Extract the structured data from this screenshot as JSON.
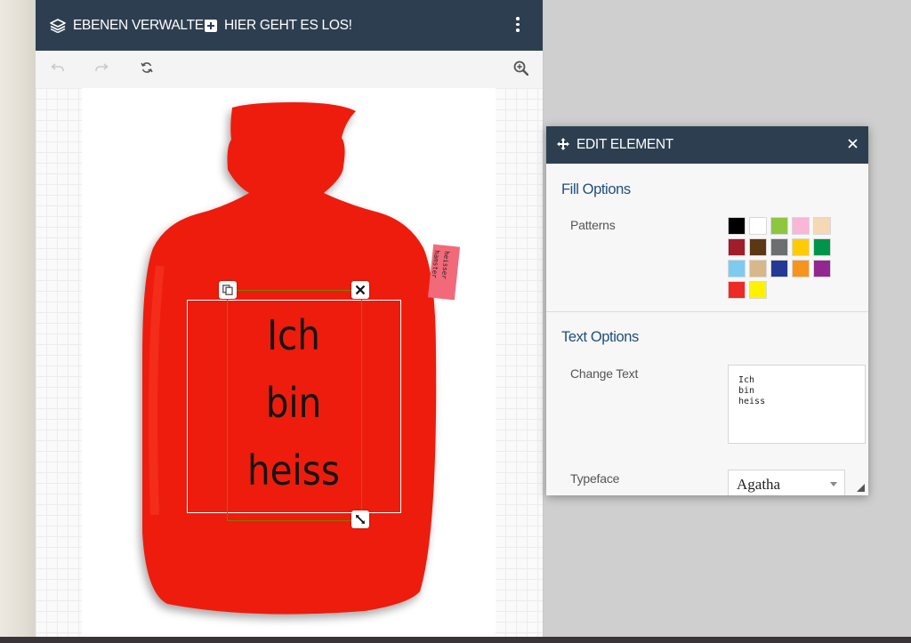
{
  "topbar": {
    "layers_label": "EBENEN VERWALTEN",
    "start_label": "HIER GEHT ES LOS!"
  },
  "toolbar": {
    "icons": [
      "undo-icon",
      "redo-icon",
      "refresh-icon",
      "zoom-in-icon"
    ]
  },
  "product": {
    "tag_text_line1": "heisser",
    "tag_text_line2": "hamster",
    "bottle_color": "#ee1f10"
  },
  "design": {
    "text_lines": [
      "Ich",
      "bin",
      "heiss"
    ]
  },
  "edit_panel": {
    "title": "EDIT ELEMENT",
    "fill_options_title": "Fill Options",
    "patterns_label": "Patterns",
    "swatch_colors": [
      "#000000",
      "#ffffff",
      "#8dc63f",
      "#f9b6d6",
      "#f5d9b4",
      "#a01d2c",
      "#5b3714",
      "#6d6e71",
      "#ffcb05",
      "#00954a",
      "#7fcaef",
      "#d6b88a",
      "#243896",
      "#f7941d",
      "#92278f",
      "#ee2a24",
      "#fff200"
    ],
    "text_options_title": "Text Options",
    "change_text_label": "Change Text",
    "text_value": "Ich\nbin\nheiss",
    "typeface_label": "Typeface",
    "typeface_value": "Agatha"
  },
  "colors": {
    "header_bg": "#2d3e50",
    "section_title": "#1f4e7d"
  }
}
